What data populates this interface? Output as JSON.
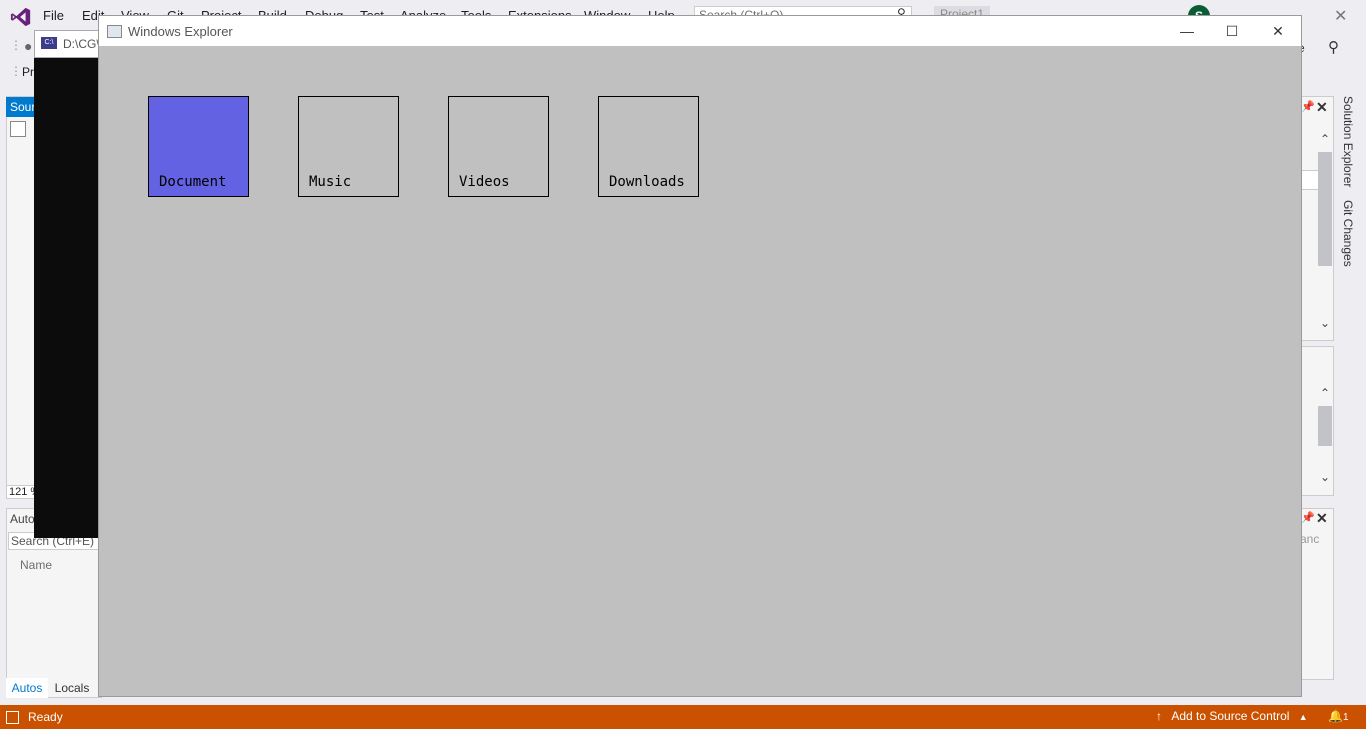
{
  "vs": {
    "menu": [
      "File",
      "Edit",
      "View",
      "Git",
      "Project",
      "Build",
      "Debug",
      "Test",
      "Analyze",
      "Tools",
      "Extensions",
      "Window",
      "Help"
    ],
    "search_placeholder": "Search (Ctrl+Q)",
    "project_name": "Project1",
    "avatar_initial": "S",
    "toolbar_label": "Pr",
    "source_tab": "Sour",
    "zoom": "121 %",
    "console_path": "D:\\CG\\",
    "autos_title": "Auto",
    "autos_search": "Search (Ctrl+E)",
    "autos_col_name": "Name",
    "tab_autos": "Autos",
    "tab_locals": "Locals",
    "right_vtab_solution": "Solution Explorer",
    "right_vtab_git": "Git Changes",
    "right_clipped_text": "e",
    "right_clipped_text2": "anc",
    "status": "Ready",
    "source_control": "Add to Source Control",
    "notif_count": "1"
  },
  "explorer": {
    "title": "Windows Explorer",
    "folders": [
      {
        "label": "Document",
        "selected": true
      },
      {
        "label": "Music",
        "selected": false
      },
      {
        "label": "Videos",
        "selected": false
      },
      {
        "label": "Downloads",
        "selected": false
      }
    ]
  },
  "colors": {
    "selected_folder": "#6262e2",
    "app_background": "#c0c0c0",
    "statusbar": "#ca5100",
    "vs_accent": "#007acc"
  }
}
